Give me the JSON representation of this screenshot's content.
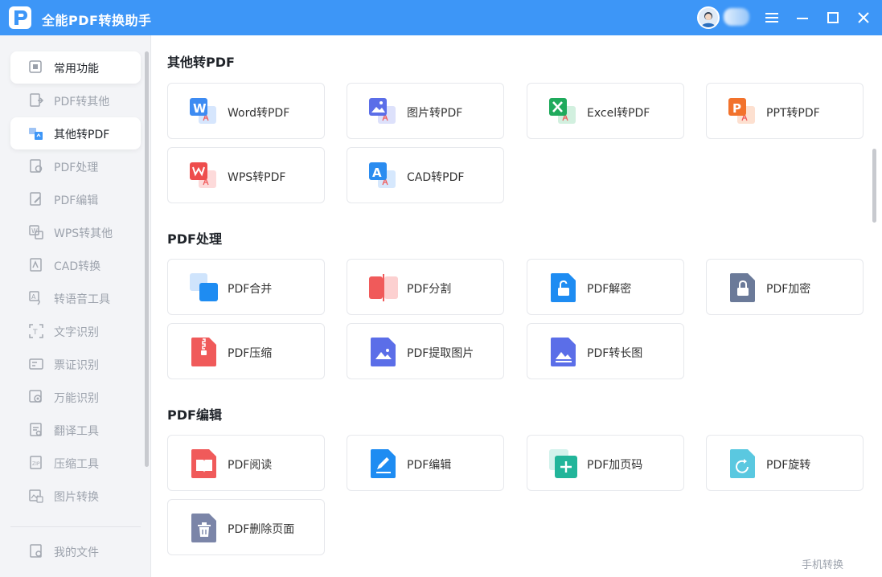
{
  "app": {
    "title": "全能PDF转换助手",
    "accent": "#3d96f7"
  },
  "sidebar": {
    "items": [
      {
        "label": "常用功能",
        "icon": "grid-icon"
      },
      {
        "label": "PDF转其他",
        "icon": "pdf-export-icon"
      },
      {
        "label": "其他转PDF",
        "icon": "pdf-import-icon",
        "active": true
      },
      {
        "label": "PDF处理",
        "icon": "pdf-process-icon"
      },
      {
        "label": "PDF编辑",
        "icon": "pdf-edit-icon"
      },
      {
        "label": "WPS转其他",
        "icon": "wps-icon"
      },
      {
        "label": "CAD转换",
        "icon": "cad-icon"
      },
      {
        "label": "转语音工具",
        "icon": "speech-icon"
      },
      {
        "label": "文字识别",
        "icon": "ocr-icon"
      },
      {
        "label": "票证识别",
        "icon": "ticket-icon"
      },
      {
        "label": "万能识别",
        "icon": "eye-icon"
      },
      {
        "label": "翻译工具",
        "icon": "translate-icon"
      },
      {
        "label": "压缩工具",
        "icon": "zip-icon"
      },
      {
        "label": "图片转换",
        "icon": "image-icon"
      }
    ],
    "my_files": "我的文件"
  },
  "sections": [
    {
      "title": "其他转PDF",
      "cards": [
        {
          "label": "Word转PDF",
          "icon": "word-icon",
          "color": "#3d8bf2"
        },
        {
          "label": "图片转PDF",
          "icon": "image-icon",
          "color": "#5b6ee8"
        },
        {
          "label": "Excel转PDF",
          "icon": "excel-icon",
          "color": "#1faa5c"
        },
        {
          "label": "PPT转PDF",
          "icon": "ppt-icon",
          "color": "#f2722c"
        },
        {
          "label": "WPS转PDF",
          "icon": "wps-icon",
          "color": "#ee4d4d"
        },
        {
          "label": "CAD转PDF",
          "icon": "cad-icon",
          "color": "#2a8cf0"
        }
      ]
    },
    {
      "title": "PDF处理",
      "cards": [
        {
          "label": "PDF合并",
          "icon": "merge-icon",
          "color": "#1e8cf2"
        },
        {
          "label": "PDF分割",
          "icon": "split-icon",
          "color": "#f05a5a"
        },
        {
          "label": "PDF解密",
          "icon": "unlock-icon",
          "color": "#1e8cf2"
        },
        {
          "label": "PDF加密",
          "icon": "lock-icon",
          "color": "#6b7a99"
        },
        {
          "label": "PDF压缩",
          "icon": "compress-icon",
          "color": "#f05a5a"
        },
        {
          "label": "PDF提取图片",
          "icon": "extract-image-icon",
          "color": "#5b6ee8"
        },
        {
          "label": "PDF转长图",
          "icon": "long-image-icon",
          "color": "#5b6ee8"
        }
      ]
    },
    {
      "title": "PDF编辑",
      "cards": [
        {
          "label": "PDF阅读",
          "icon": "read-icon",
          "color": "#f05a5a"
        },
        {
          "label": "PDF编辑",
          "icon": "edit-icon",
          "color": "#1e8cf2"
        },
        {
          "label": "PDF加页码",
          "icon": "page-number-icon",
          "color": "#22b59a"
        },
        {
          "label": "PDF旋转",
          "icon": "rotate-icon",
          "color": "#5ac8e0"
        },
        {
          "label": "PDF删除页面",
          "icon": "delete-page-icon",
          "color": "#7b85a8"
        }
      ]
    }
  ],
  "footer": {
    "mobile_link": "手机转换"
  }
}
